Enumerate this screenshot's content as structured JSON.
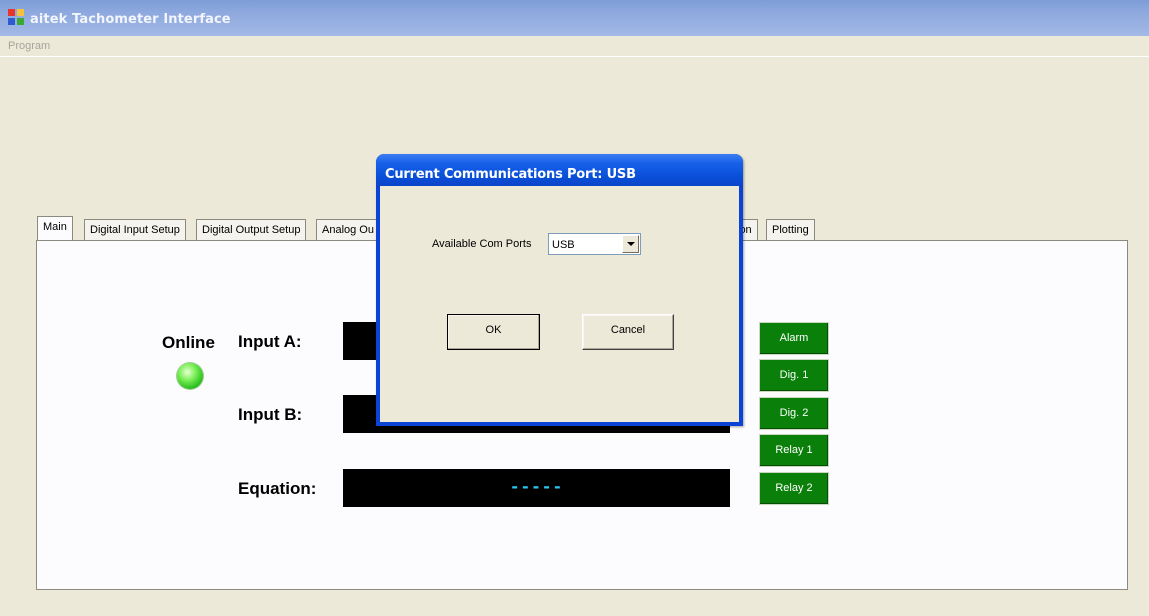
{
  "window": {
    "title": "aitek Tachometer Interface",
    "icon": "app-window-icon"
  },
  "menu": {
    "items": [
      "Program"
    ]
  },
  "tabs": [
    {
      "label": "Main",
      "active": true
    },
    {
      "label": "Digital Input Setup"
    },
    {
      "label": "Digital Output Setup"
    },
    {
      "label": "Analog Ou"
    },
    {
      "label": "ion"
    },
    {
      "label": "Plotting"
    }
  ],
  "main": {
    "online_label": "Online",
    "online_led": "green-status-led",
    "input_a_label": "Input A:",
    "input_b_label": "Input B:",
    "equation_label": "Equation:",
    "equation_value": "-----",
    "status_buttons": [
      "Alarm",
      "Dig. 1",
      "Dig. 2",
      "Relay 1",
      "Relay 2"
    ],
    "status_color": "#0A800A",
    "display_color": "#000000",
    "value_color": "#2BC4F0"
  },
  "dialog": {
    "title": "Current Communications Port: USB",
    "combo_label": "Available Com Ports",
    "combo_value": "USB",
    "ok_label": "OK",
    "cancel_label": "Cancel",
    "accent": "#0A43D6"
  }
}
